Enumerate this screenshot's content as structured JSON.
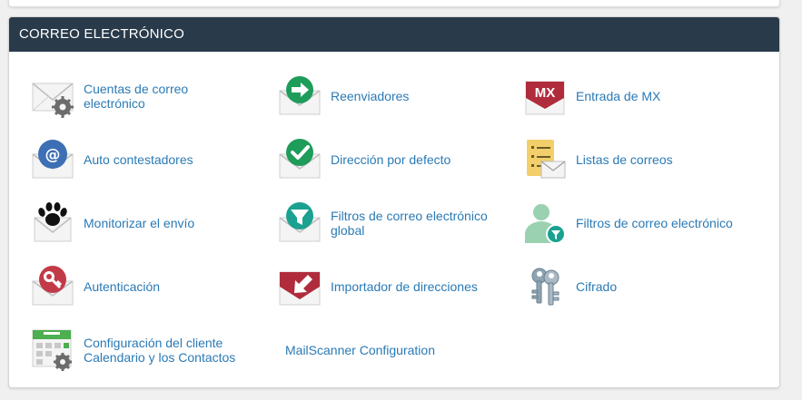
{
  "section": {
    "title": "CORREO ELECTRÓNICO"
  },
  "items": [
    {
      "label": "Cuentas de correo electrónico",
      "icon": "email-accounts-icon"
    },
    {
      "label": "Reenviadores",
      "icon": "forwarders-icon"
    },
    {
      "label": "Entrada de MX",
      "icon": "mx-entry-icon"
    },
    {
      "label": "Auto contestadores",
      "icon": "autoresponders-icon"
    },
    {
      "label": "Dirección por defecto",
      "icon": "default-address-icon"
    },
    {
      "label": "Listas de correos",
      "icon": "mailing-lists-icon"
    },
    {
      "label": "Monitorizar el envío",
      "icon": "track-delivery-icon"
    },
    {
      "label": "Filtros de correo electrónico global",
      "icon": "global-email-filters-icon"
    },
    {
      "label": "Filtros de correo electrónico",
      "icon": "email-filters-icon"
    },
    {
      "label": "Autenticación",
      "icon": "authentication-icon"
    },
    {
      "label": "Importador de direcciones",
      "icon": "address-importer-icon"
    },
    {
      "label": "Cifrado",
      "icon": "encryption-icon"
    },
    {
      "label": "Configuración del cliente Calendario y los Contactos",
      "icon": "calendar-contacts-icon"
    },
    {
      "label": "MailScanner Configuration",
      "icon": ""
    }
  ],
  "icon_glyphs": {
    "mx": "MX",
    "at": "@"
  },
  "colors": {
    "header_bg": "#293a4a",
    "link": "#2a7ab5",
    "green": "#1e9c5a",
    "red": "#c23a48",
    "blue": "#3c6fb4",
    "teal": "#1aa18f",
    "mint": "#9ad1b1",
    "dark_red": "#b02c3c",
    "cal_green": "#4caf50"
  }
}
